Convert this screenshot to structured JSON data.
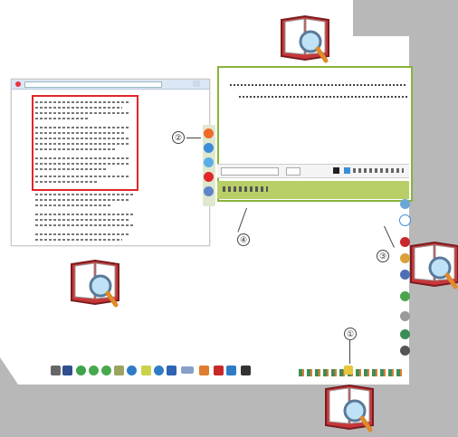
{
  "callouts": {
    "c1": "①",
    "c2": "②",
    "c3": "③",
    "c4": "④"
  },
  "colors": {
    "highlight_red": "#e0262a",
    "editor_green": "#88b43a",
    "footer_green": "#b8cf68",
    "bg_gray": "#b8b8b8"
  },
  "icons": {
    "book_magnifier": "book-magnifier-icon"
  }
}
